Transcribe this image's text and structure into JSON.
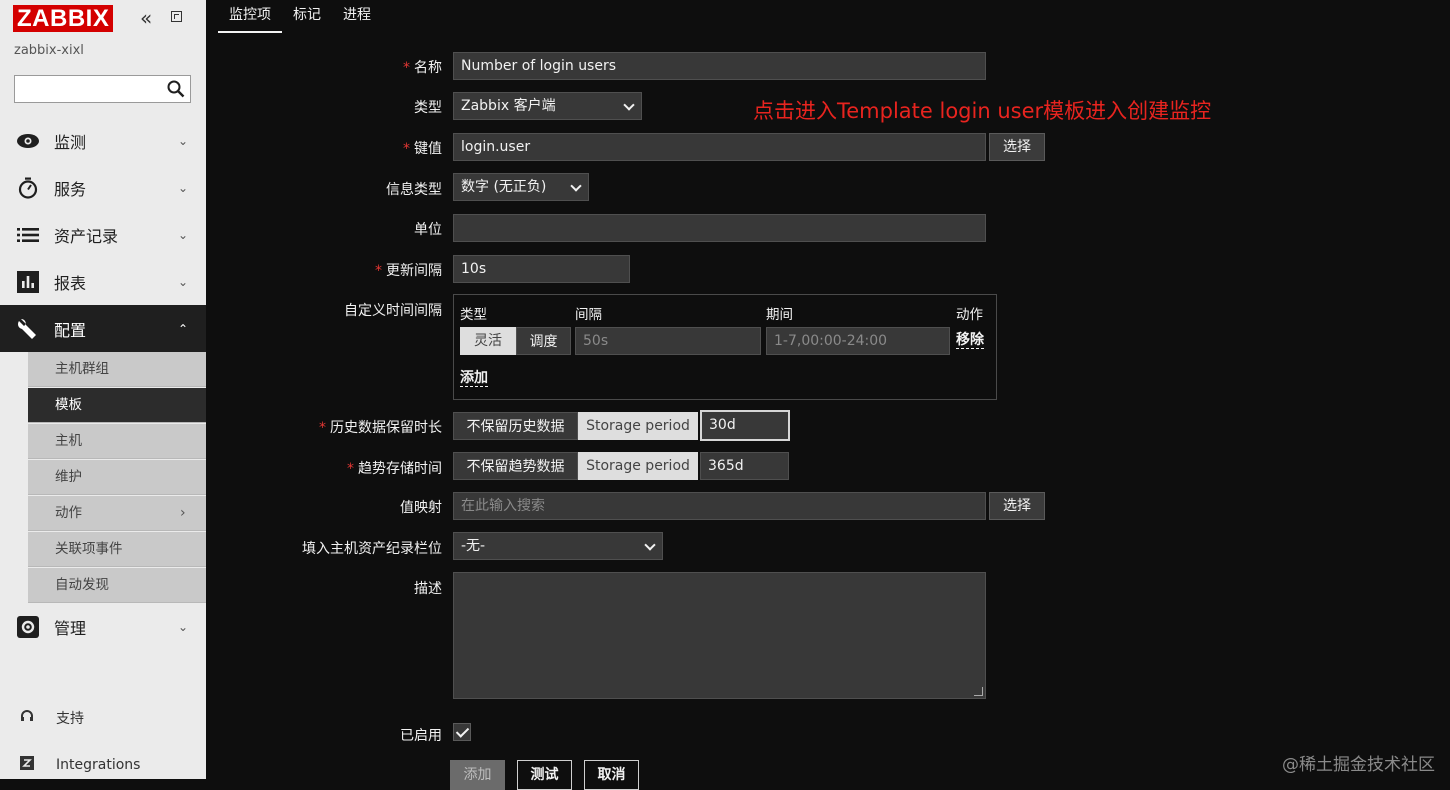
{
  "sidebar": {
    "logo": "ZABBIX",
    "server_name": "zabbix-xixl",
    "search_placeholder": "",
    "menu": {
      "monitoring": "监测",
      "services": "服务",
      "inventory": "资产记录",
      "reports": "报表",
      "configuration": "配置",
      "administration": "管理"
    },
    "config_submenu": {
      "host_groups": "主机群组",
      "templates": "模板",
      "hosts": "主机",
      "maintenance": "维护",
      "actions": "动作",
      "event_correlation": "关联项事件",
      "discovery": "自动发现"
    },
    "bottom": {
      "support": "支持",
      "integrations": "Integrations"
    }
  },
  "tabs": [
    "监控项",
    "标记",
    "进程"
  ],
  "form": {
    "name_label": "名称",
    "name_value": "Number of login users",
    "type_label": "类型",
    "type_value": "Zabbix 客户端",
    "key_label": "键值",
    "key_value": "login.user",
    "select_button": "选择",
    "info_type_label": "信息类型",
    "info_type_value": "数字 (无正负)",
    "units_label": "单位",
    "units_value": "",
    "interval_label": "更新间隔",
    "interval_value": "10s",
    "custom_intervals_label": "自定义时间间隔",
    "custom_intervals": {
      "col_type": "类型",
      "col_interval": "间隔",
      "col_period": "期间",
      "col_action": "动作",
      "flexible": "灵活",
      "scheduling": "调度",
      "interval_placeholder": "50s",
      "period_placeholder": "1-7,00:00-24:00",
      "remove": "移除",
      "add": "添加"
    },
    "history_label": "历史数据保留时长",
    "history_do_not_keep": "不保留历史数据",
    "storage_period": "Storage period",
    "history_value": "30d",
    "trends_label": "趋势存储时间",
    "trends_do_not_keep": "不保留趋势数据",
    "trends_value": "365d",
    "valuemap_label": "值映射",
    "valuemap_placeholder": "在此输入搜索",
    "inventory_label": "填入主机资产纪录栏位",
    "inventory_value": "-无-",
    "description_label": "描述",
    "enabled_label": "已启用",
    "enabled": true,
    "add_button": "添加",
    "test_button": "测试",
    "cancel_button": "取消"
  },
  "annotation": "点击进入Template login user模板进入创建监控",
  "watermark": "@稀土掘金技术社区",
  "colors": {
    "logo_red": "#d40000",
    "required_star": "#e33734",
    "annotation_red": "#e8241f",
    "background": "#0e0e0e"
  }
}
